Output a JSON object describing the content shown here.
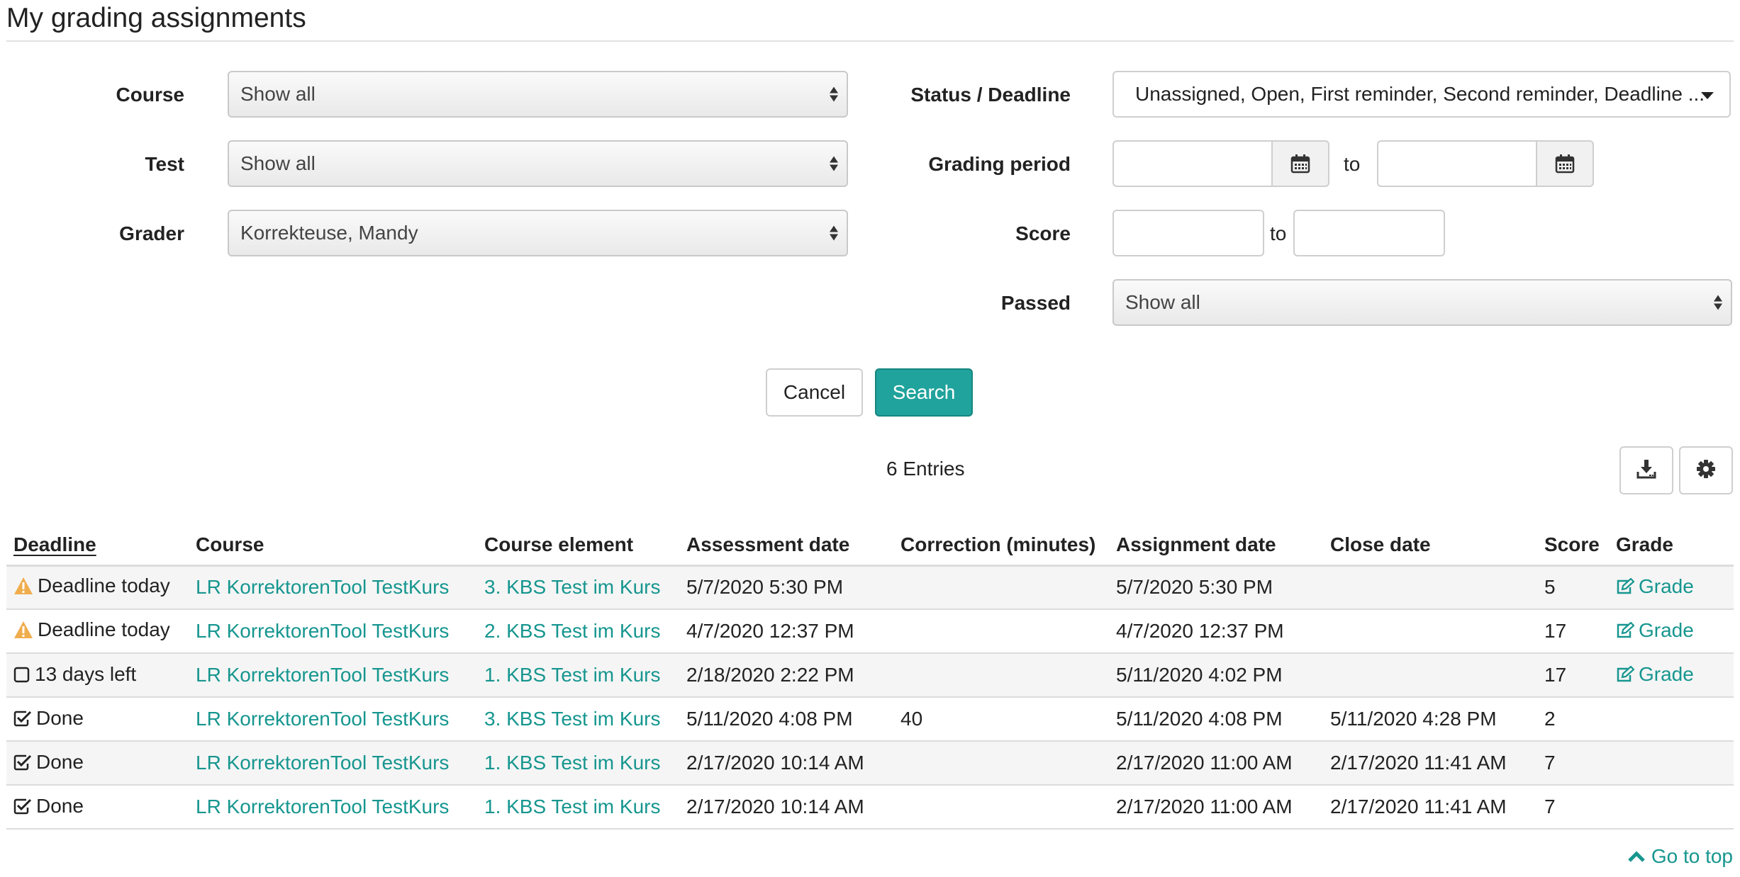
{
  "page": {
    "title": "My grading assignments"
  },
  "filters": {
    "course": {
      "label": "Course",
      "value": "Show all"
    },
    "test": {
      "label": "Test",
      "value": "Show all"
    },
    "grader": {
      "label": "Grader",
      "value": "Korrekteuse, Mandy"
    },
    "status_deadline": {
      "label": "Status / Deadline",
      "value": "Unassigned, Open, First reminder, Second reminder, Deadline ..."
    },
    "grading_period": {
      "label": "Grading period",
      "to_label": "to"
    },
    "score": {
      "label": "Score",
      "to_label": "to"
    },
    "passed": {
      "label": "Passed",
      "value": "Show all"
    }
  },
  "actions": {
    "cancel_label": "Cancel",
    "search_label": "Search"
  },
  "results": {
    "count_text": "6 Entries"
  },
  "table": {
    "columns": [
      "Deadline",
      "Course",
      "Course element",
      "Assessment date",
      "Correction (minutes)",
      "Assignment date",
      "Close date",
      "Score",
      "Grade"
    ],
    "rows": [
      {
        "status_icon": "warning-icon",
        "deadline": "Deadline today",
        "course": "LR KorrektorenTool TestKurs",
        "element": "3. KBS Test im Kurs",
        "assessment_date": "5/7/2020 5:30 PM",
        "correction": "",
        "assignment_date": "5/7/2020 5:30 PM",
        "close_date": "",
        "score": "5",
        "grade": "Grade"
      },
      {
        "status_icon": "warning-icon",
        "deadline": "Deadline today",
        "course": "LR KorrektorenTool TestKurs",
        "element": "2. KBS Test im Kurs",
        "assessment_date": "4/7/2020 12:37 PM",
        "correction": "",
        "assignment_date": "4/7/2020 12:37 PM",
        "close_date": "",
        "score": "17",
        "grade": "Grade"
      },
      {
        "status_icon": "empty-checkbox-icon",
        "deadline": "13 days left",
        "course": "LR KorrektorenTool TestKurs",
        "element": "1. KBS Test im Kurs",
        "assessment_date": "2/18/2020 2:22 PM",
        "correction": "",
        "assignment_date": "5/11/2020 4:02 PM",
        "close_date": "",
        "score": "17",
        "grade": "Grade"
      },
      {
        "status_icon": "checked-checkbox-icon",
        "deadline": "Done",
        "course": "LR KorrektorenTool TestKurs",
        "element": "3. KBS Test im Kurs",
        "assessment_date": "5/11/2020 4:08 PM",
        "correction": "40",
        "assignment_date": "5/11/2020 4:08 PM",
        "close_date": "5/11/2020 4:28 PM",
        "score": "2",
        "grade": ""
      },
      {
        "status_icon": "checked-checkbox-icon",
        "deadline": "Done",
        "course": "LR KorrektorenTool TestKurs",
        "element": "1. KBS Test im Kurs",
        "assessment_date": "2/17/2020 10:14 AM",
        "correction": "",
        "assignment_date": "2/17/2020 11:00 AM",
        "close_date": "2/17/2020 11:41 AM",
        "score": "7",
        "grade": ""
      },
      {
        "status_icon": "checked-checkbox-icon",
        "deadline": "Done",
        "course": "LR KorrektorenTool TestKurs",
        "element": "1. KBS Test im Kurs",
        "assessment_date": "2/17/2020 10:14 AM",
        "correction": "",
        "assignment_date": "2/17/2020 11:00 AM",
        "close_date": "2/17/2020 11:41 AM",
        "score": "7",
        "grade": ""
      }
    ]
  },
  "footer": {
    "go_top_label": "Go to top"
  },
  "colors": {
    "accent": "#20a39c",
    "link": "#16968f",
    "warning": "#f0ad4e"
  }
}
